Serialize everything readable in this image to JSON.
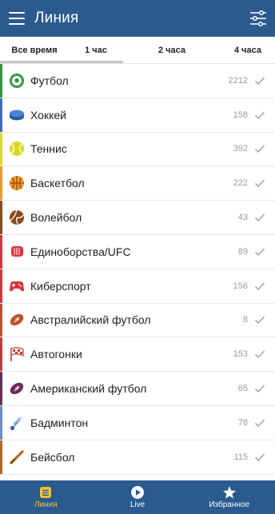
{
  "header": {
    "title": "Линия"
  },
  "tabs": [
    {
      "label": "Все время"
    },
    {
      "label": "1 час"
    },
    {
      "label": "2 часа"
    },
    {
      "label": "4 часа"
    }
  ],
  "sports": [
    {
      "name": "Футбол",
      "count": "2212",
      "color": "#2e9b3a",
      "icon": "soccer-ball-icon"
    },
    {
      "name": "Хоккей",
      "count": "158",
      "color": "#3d6cc4",
      "icon": "hockey-puck-icon"
    },
    {
      "name": "Теннис",
      "count": "392",
      "color": "#d9d91f",
      "icon": "tennis-ball-icon"
    },
    {
      "name": "Баскетбол",
      "count": "222",
      "color": "#f0962a",
      "icon": "basketball-icon"
    },
    {
      "name": "Волейбол",
      "count": "43",
      "color": "#8a4a1c",
      "icon": "volleyball-icon"
    },
    {
      "name": "Единоборства/UFC",
      "count": "89",
      "color": "#d8343c",
      "icon": "boxing-glove-icon"
    },
    {
      "name": "Киберспорт",
      "count": "156",
      "color": "#d8343c",
      "icon": "gamepad-icon"
    },
    {
      "name": "Австралийский футбол",
      "count": "8",
      "color": "#c2502a",
      "icon": "australian-football-icon"
    },
    {
      "name": "Автогонки",
      "count": "153",
      "color": "#c43a3a",
      "icon": "checkered-flag-icon"
    },
    {
      "name": "Американский футбол",
      "count": "65",
      "color": "#6a2c5c",
      "icon": "american-football-icon"
    },
    {
      "name": "Бадминтон",
      "count": "78",
      "color": "#6b8ec8",
      "icon": "shuttlecock-icon"
    },
    {
      "name": "Бейсбол",
      "count": "115",
      "color": "#b5671e",
      "icon": "baseball-bat-icon"
    }
  ],
  "bottom_nav": [
    {
      "label": "Линия",
      "icon": "list-icon",
      "active": true
    },
    {
      "label": "Live",
      "icon": "play-icon",
      "active": false
    },
    {
      "label": "Избранное",
      "icon": "star-icon",
      "active": false
    }
  ],
  "colors": {
    "primary": "#2a5a8e",
    "accent": "#f4c432"
  }
}
